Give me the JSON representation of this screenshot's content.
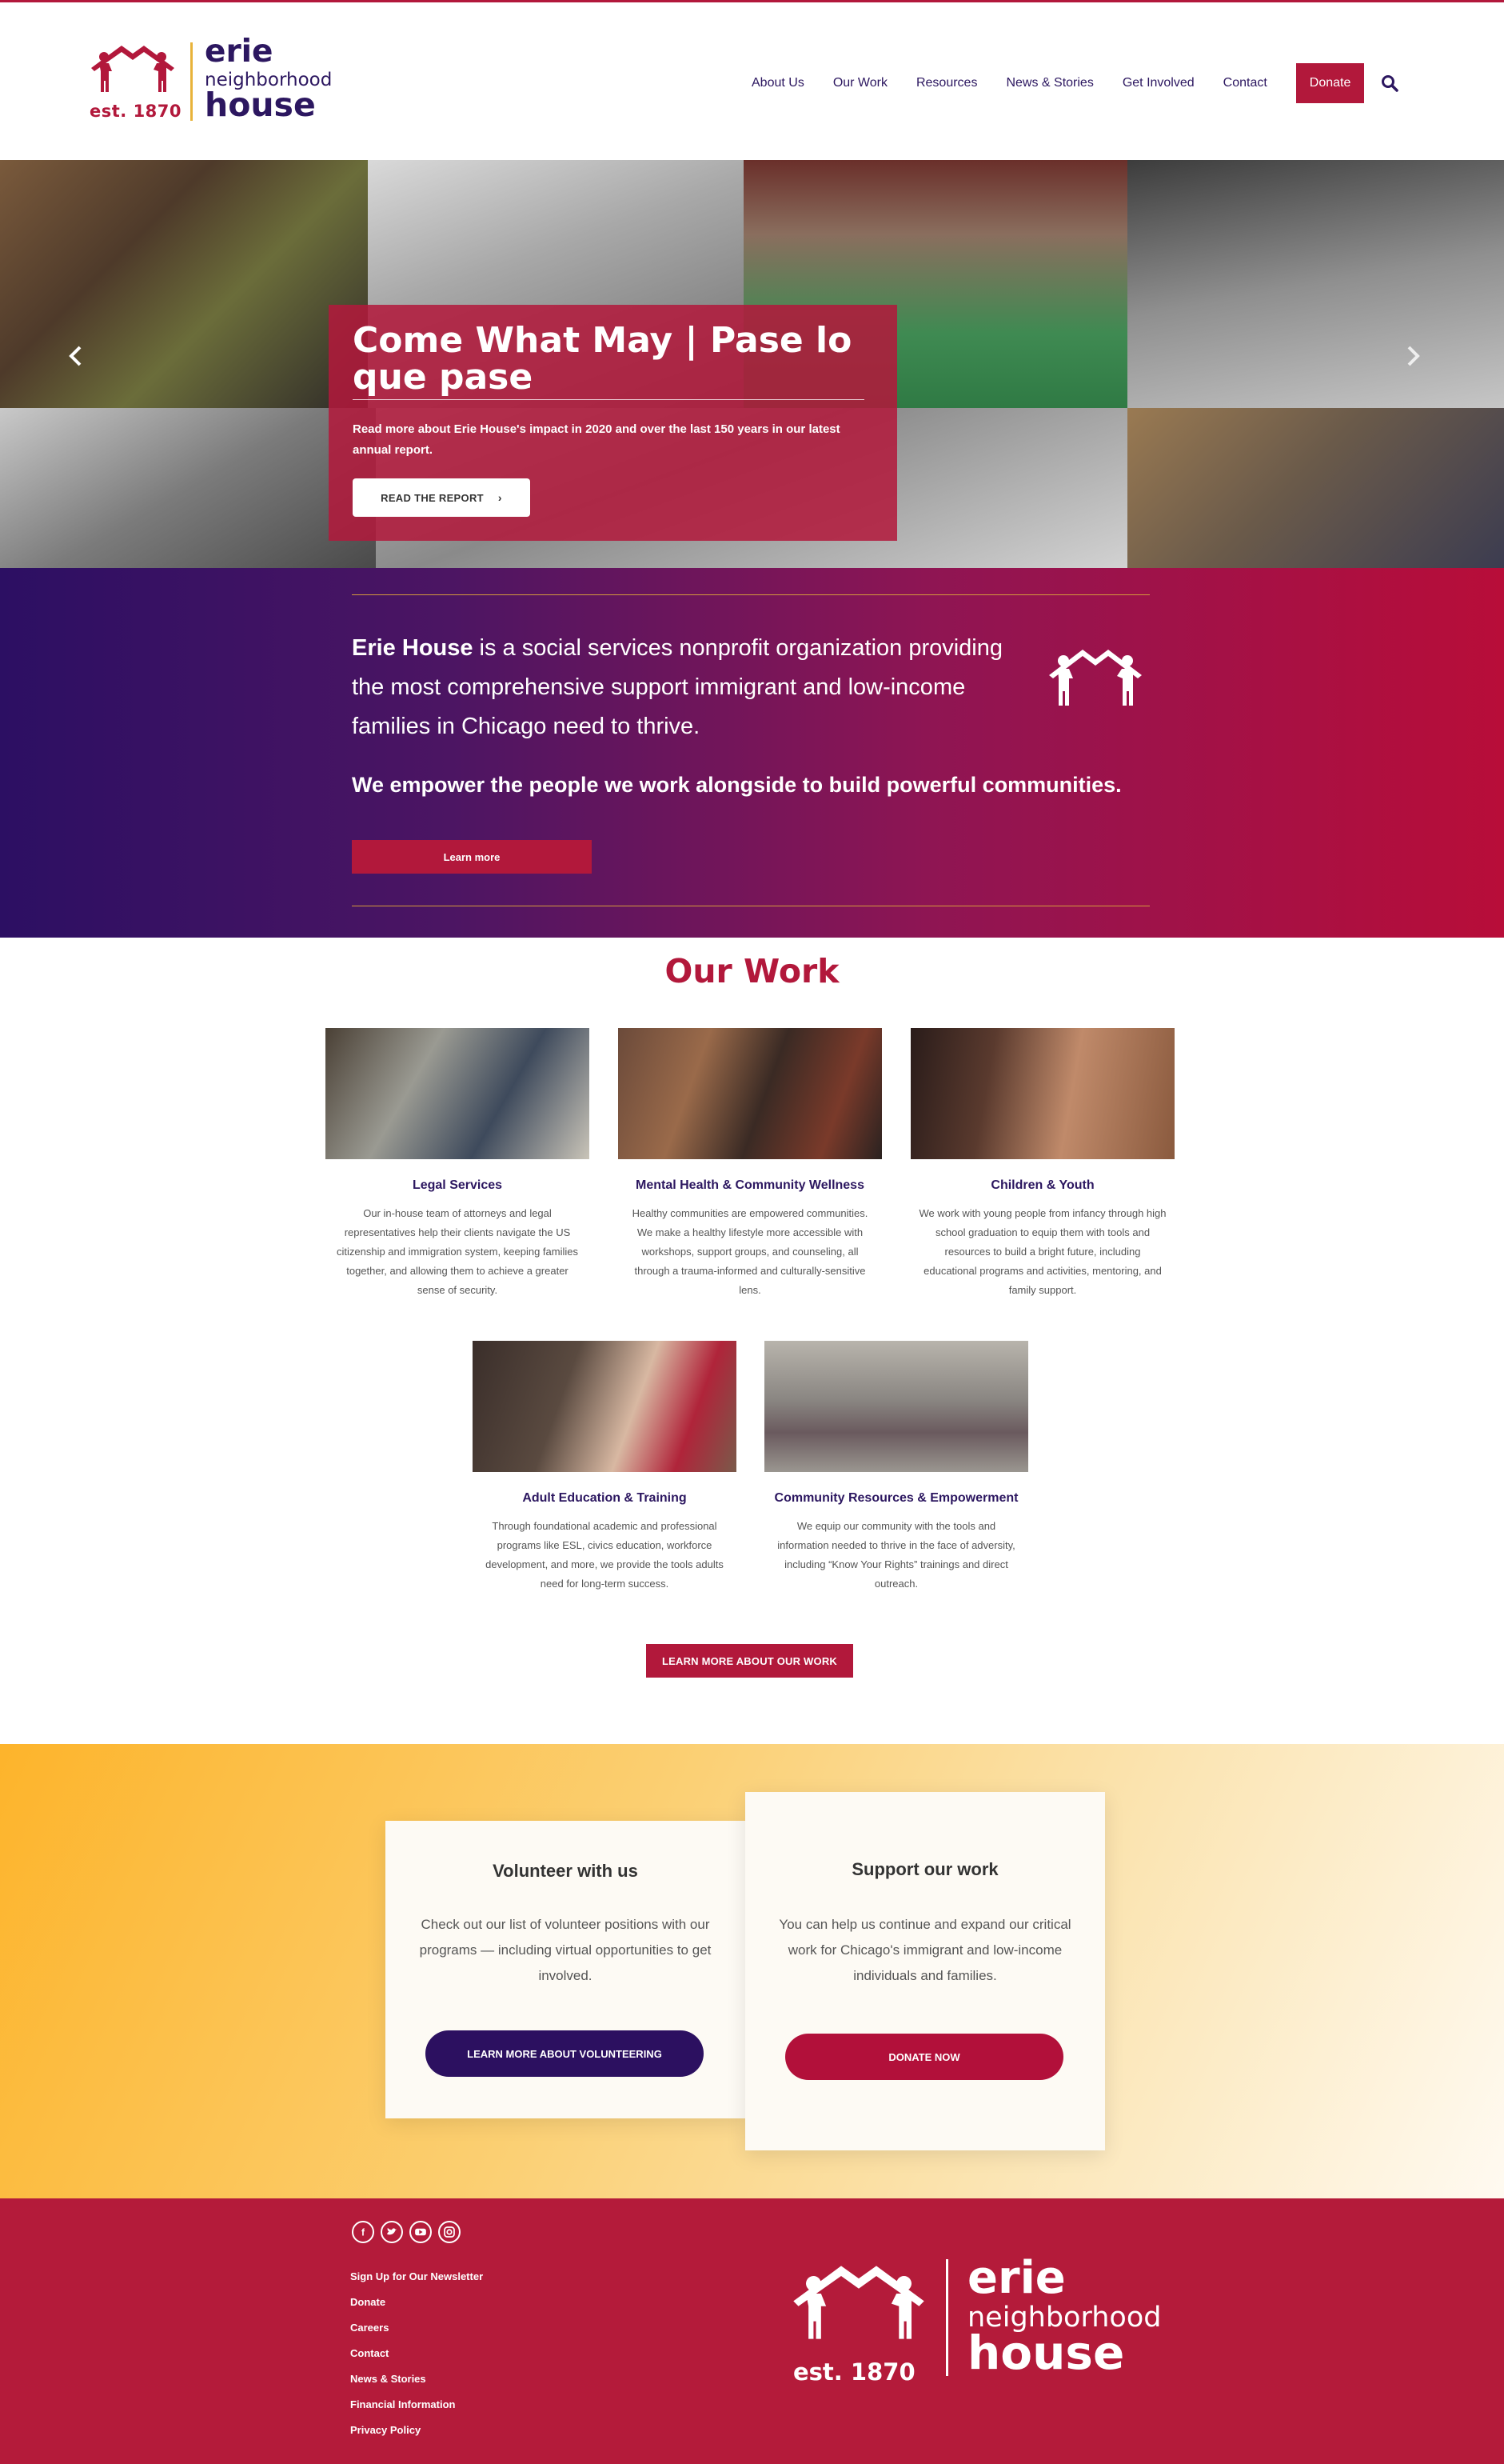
{
  "brand": {
    "name_line1": "erie",
    "name_line2": "neighborhood",
    "name_line3": "house",
    "est": "est. 1870",
    "colors": {
      "primary": "#b2183b",
      "navy": "#2c1760",
      "gold": "#e8b33a"
    }
  },
  "nav": {
    "items": [
      "About Us",
      "Our Work",
      "Resources",
      "News & Stories",
      "Get Involved",
      "Contact"
    ],
    "donate_label": "Donate",
    "search_icon": "search-icon"
  },
  "hero": {
    "title": "Come What May | Pase lo que pase",
    "subtitle": "Read more about Erie House's impact in 2020 and over the last 150 years in our latest annual report.",
    "button_label": "READ THE REPORT",
    "prev_icon": "chevron-left-icon",
    "next_icon": "chevron-right-icon"
  },
  "mission": {
    "org_name": "Erie House",
    "statement": " is a social services nonprofit organization providing the most comprehensive support immigrant and low-income families in Chicago need to thrive.",
    "tagline": "We empower the people we work alongside to build powerful communities.",
    "button_label": "Learn more"
  },
  "our_work": {
    "title": "Our Work",
    "programs": [
      {
        "title": "Legal Services",
        "text": "Our in-house team of attorneys and legal representatives help their clients navigate the US citizenship and immigration system, keeping families together, and allowing them to achieve a greater sense of security."
      },
      {
        "title": "Mental Health & Community Wellness",
        "text": "Healthy communities are empowered communities. We make a healthy lifestyle more accessible with workshops, support groups, and counseling, all through a trauma-informed and culturally-sensitive lens."
      },
      {
        "title": "Children & Youth",
        "text": "We work with young people from infancy through high school graduation to equip them with tools and resources to build a bright future, including educational programs and activities, mentoring, and family support."
      },
      {
        "title": "Adult Education & Training",
        "text": "Through foundational academic and professional programs like ESL, civics education, workforce development, and more, we provide the tools adults need for long-term success."
      },
      {
        "title": "Community Resources & Empowerment",
        "text": "We equip our community with the tools and information needed to thrive in the face of adversity, including “Know Your Rights” trainings and direct outreach."
      }
    ],
    "button_label": "LEARN MORE ABOUT OUR WORK"
  },
  "cta": {
    "volunteer": {
      "title": "Volunteer with us",
      "text": "Check out our list of volunteer positions with our programs — including virtual opportunities to get involved.",
      "button_label": "LEARN MORE ABOUT VOLUNTEERING"
    },
    "support": {
      "title": "Support our work",
      "text": "You can help us continue and expand our critical work for Chicago's immigrant and low-income individuals and families.",
      "button_label": "DONATE NOW"
    }
  },
  "footer": {
    "social_icons": [
      "facebook-icon",
      "twitter-icon",
      "youtube-icon",
      "instagram-icon"
    ],
    "links": [
      "Sign Up for Our Newsletter",
      "Donate",
      "Careers",
      "Contact",
      "News & Stories",
      "Financial Information",
      "Privacy Policy"
    ]
  }
}
